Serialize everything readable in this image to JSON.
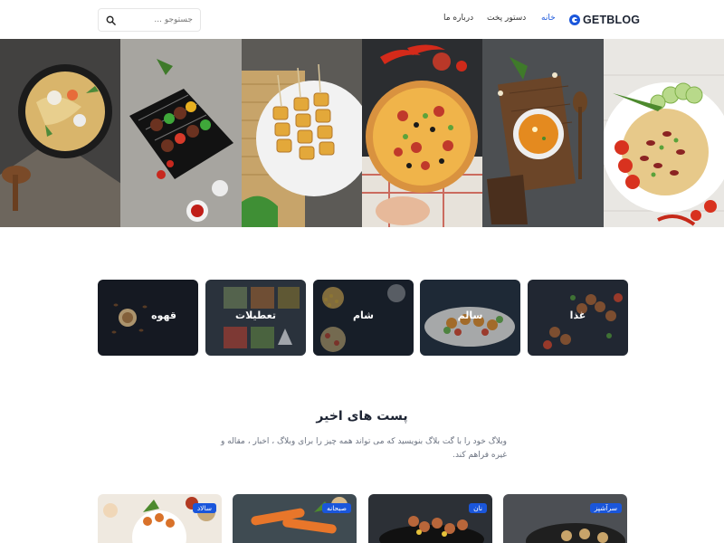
{
  "header": {
    "logo": "GETBLOG",
    "nav": [
      {
        "label": "خانه",
        "active": true
      },
      {
        "label": "دستور پخت",
        "active": false
      },
      {
        "label": "درباره ما",
        "active": false
      }
    ],
    "search": {
      "placeholder": "جستوجو ...",
      "icon": "search-icon"
    }
  },
  "hero": {
    "tiles": [
      "noodle-bowl",
      "meat-skewers",
      "fried-skewers",
      "pizza",
      "soup-bowl",
      "rice-plate"
    ]
  },
  "categories": [
    {
      "label": "غذا"
    },
    {
      "label": "سالم"
    },
    {
      "label": "شام"
    },
    {
      "label": "تعطیلات"
    },
    {
      "label": "قهوه"
    }
  ],
  "recent": {
    "title": "پست های اخیر",
    "description": "وبلاگ خود را با گت بلاگ بنویسید که می تواند همه چیز را برای وبلاگ ، اخبار ، مقاله و غیره فراهم کند."
  },
  "posts": [
    {
      "badge": "سرآشپز"
    },
    {
      "badge": "نان"
    },
    {
      "badge": "صبحانه"
    },
    {
      "badge": "سالاد"
    }
  ],
  "colors": {
    "accent": "#1a56db",
    "heading": "#1d2433",
    "muted": "#6b7280"
  }
}
